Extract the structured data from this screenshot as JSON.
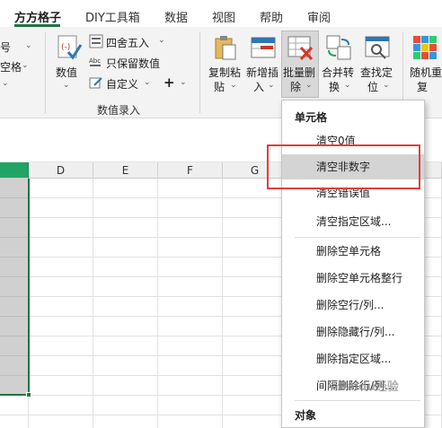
{
  "tabs": [
    {
      "label": "方方格子",
      "active": true
    },
    {
      "label": "DIY工具箱",
      "active": false
    },
    {
      "label": "数据",
      "active": false
    },
    {
      "label": "视图",
      "active": false
    },
    {
      "label": "帮助",
      "active": false
    },
    {
      "label": "审阅",
      "active": false
    }
  ],
  "ribbon": {
    "left_partial": [
      "号",
      "空格",
      ""
    ],
    "numeric_group": {
      "value_button": "数值",
      "round": "四舍五入",
      "keep_value": "只保留数值",
      "custom": "自定义",
      "plus": "+",
      "group_label": "数值录入"
    },
    "buttons": {
      "copy_paste": [
        "复制粘",
        "贴"
      ],
      "add_insert": [
        "新增插",
        "入"
      ],
      "batch_delete": [
        "批量删",
        "除"
      ],
      "merge_convert": [
        "合并转",
        "换"
      ],
      "find_locate": [
        "查找定",
        "位"
      ],
      "random_repeat": [
        "随机重",
        "复"
      ]
    }
  },
  "grid": {
    "columns": [
      "D",
      "E",
      "F",
      "G"
    ]
  },
  "dropdown": {
    "header1": "单元格",
    "items_group1": [
      "清空0值",
      "清空非数字",
      "清空错误值",
      "清空指定区域..."
    ],
    "items_group2": [
      "删除空单元格",
      "删除空单元格整行",
      "删除空行/列...",
      "删除隐藏行/列...",
      "删除指定区域...",
      "间隔删除行/列..."
    ],
    "header2": "对象",
    "hovered_item": "清空非数字"
  },
  "watermark": "Baidu经验",
  "colors": {
    "accent_green": "#217346",
    "selection_green": "#21a366",
    "highlight_red": "#e0403a"
  }
}
